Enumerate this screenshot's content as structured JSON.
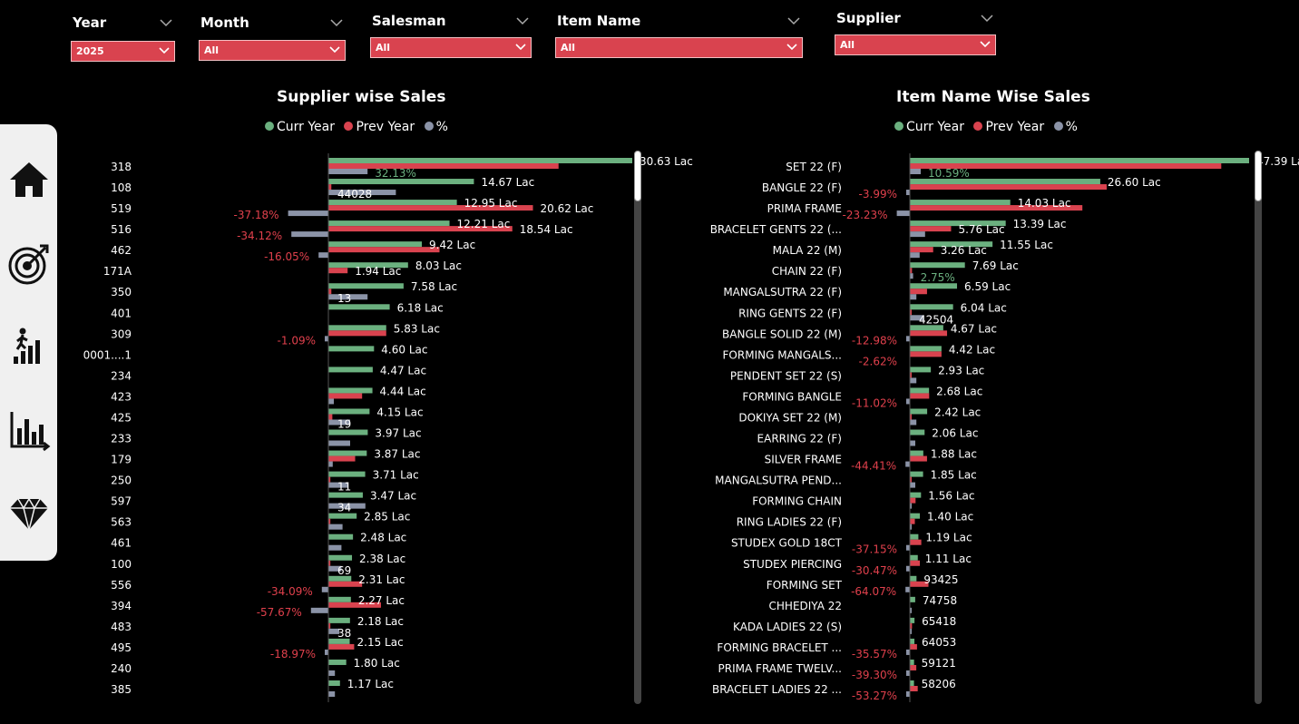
{
  "filters": [
    {
      "title": "Year",
      "value": "2025"
    },
    {
      "title": "Month",
      "value": "All"
    },
    {
      "title": "Salesman",
      "value": "All"
    },
    {
      "title": "Item Name",
      "value": "All"
    },
    {
      "title": "Supplier",
      "value": "All"
    }
  ],
  "nav": {
    "icons": [
      "home-icon",
      "target-icon",
      "growth-icon",
      "bar-chart-icon",
      "diamond-icon"
    ]
  },
  "colors": {
    "curr": "#6bb07f",
    "prev": "#d9434f",
    "pct": "#8b93a7",
    "pos_label": "#6bb07f",
    "neg_label": "#e0404c"
  },
  "supplier_chart": {
    "title": "Supplier wise Sales",
    "legend": [
      "Curr Year",
      "Prev Year",
      "%"
    ]
  },
  "item_chart": {
    "title": "Item Name Wise Sales",
    "legend": [
      "Curr Year",
      "Prev Year",
      "%"
    ]
  },
  "chart_data": [
    {
      "type": "bar",
      "title": "Supplier wise Sales",
      "categories": [
        "318",
        "108",
        "519",
        "516",
        "462",
        "171A",
        "350",
        "401",
        "309",
        "0001....1",
        "234",
        "423",
        "425",
        "233",
        "179",
        "250",
        "597",
        "563",
        "461",
        "100",
        "556",
        "394",
        "483",
        "495",
        "240",
        "385"
      ],
      "series": [
        {
          "name": "Curr Year",
          "values": [
            30.63,
            14.67,
            12.95,
            12.21,
            9.42,
            8.03,
            7.58,
            6.18,
            5.83,
            4.6,
            4.47,
            4.44,
            4.15,
            3.97,
            3.87,
            3.71,
            3.47,
            2.85,
            2.48,
            2.38,
            2.31,
            2.27,
            2.18,
            2.15,
            1.8,
            1.17
          ]
        },
        {
          "name": "Prev Year",
          "values": [
            23.2,
            0.3,
            20.62,
            18.54,
            11.2,
            1.94,
            0.3,
            0,
            5.83,
            0,
            0,
            3.4,
            0.4,
            0,
            2.7,
            0.2,
            0,
            0.2,
            0,
            0.2,
            3.4,
            5.3,
            0.2,
            2.6,
            0,
            0
          ]
        },
        {
          "name": "%",
          "values": [
            32.13,
            44028,
            -37.18,
            -34.12,
            -16.05,
            0,
            13,
            0,
            -1.09,
            0,
            0,
            0,
            19,
            0,
            0,
            11,
            34,
            0,
            0,
            69,
            -34.09,
            -57.67,
            38,
            -18.97,
            0,
            0
          ]
        }
      ],
      "labels": [
        "30.63 Lac",
        "14.67 Lac",
        "12.95 Lac",
        "12.21 Lac",
        "9.42 Lac",
        "8.03 Lac",
        "7.58 Lac",
        "6.18 Lac",
        "5.83 Lac",
        "4.60 Lac",
        "4.47 Lac",
        "4.44 Lac",
        "4.15 Lac",
        "3.97 Lac",
        "3.87 Lac",
        "3.71 Lac",
        "3.47 Lac",
        "2.85 Lac",
        "2.48 Lac",
        "2.38 Lac",
        "2.31 Lac",
        "2.27 Lac",
        "2.18 Lac",
        "2.15 Lac",
        "1.80 Lac",
        "1.17 Lac"
      ],
      "prev_labels": [
        "",
        "",
        "20.62 Lac",
        "18.54 Lac",
        "",
        "1.94 Lac",
        "",
        "",
        "",
        "",
        "",
        "",
        "",
        "",
        "",
        "",
        "",
        "",
        "",
        "",
        "",
        "",
        "",
        "",
        "",
        ""
      ],
      "pct_labels": [
        "32.13%",
        "44028",
        "-37.18%",
        "-34.12%",
        "-16.05%",
        "",
        "13",
        "",
        "-1.09%",
        "",
        "",
        "",
        "19",
        "",
        "",
        "11",
        "34",
        "",
        "",
        "69",
        "-34.09%",
        "-57.67%",
        "38",
        "-18.97%",
        "",
        ""
      ],
      "pct_bar": [
        0.36,
        0.62,
        -0.37,
        -0.34,
        -0.09,
        0,
        0.36,
        0,
        -0.01,
        0,
        0,
        0.05,
        0.2,
        0.2,
        0.04,
        0.18,
        0.34,
        0.13,
        0.12,
        0.12,
        -0.06,
        -0.16,
        0.1,
        -0.02,
        0.06,
        0.06
      ]
    },
    {
      "type": "bar",
      "title": "Item Name Wise Sales",
      "categories": [
        "SET 22 (F)",
        "BANGLE 22 (F)",
        "PRIMA FRAME",
        "BRACELET GENTS 22 (...",
        "MALA 22 (M)",
        "CHAIN 22 (F)",
        "MANGALSUTRA 22 (F)",
        "RING GENTS 22 (F)",
        "BANGLE SOLID 22 (M)",
        "FORMING MANGALS...",
        "PENDENT SET 22 (S)",
        "FORMING BANGLE",
        "DOKIYA SET 22 (M)",
        "EARRING 22 (F)",
        "SILVER FRAME",
        "MANGALSUTRA PEND...",
        "FORMING CHAIN",
        "RING LADIES 22 (F)",
        "STUDEX GOLD 18CT",
        "STUDEX PIERCING",
        "FORMING SET",
        "CHHEDIYA 22",
        "KADA LADIES 22 (S)",
        "FORMING BRACELET ...",
        "PRIMA FRAME TWELV...",
        "BRACELET LADIES 22 ..."
      ],
      "series": [
        {
          "name": "Curr Year",
          "values": [
            47.39,
            26.6,
            14.03,
            13.39,
            11.55,
            7.69,
            6.59,
            6.04,
            4.67,
            4.42,
            2.93,
            2.68,
            2.42,
            2.06,
            1.88,
            1.85,
            1.56,
            1.4,
            1.19,
            1.11,
            0.93,
            0.75,
            0.65,
            0.64,
            0.59,
            0.58
          ]
        },
        {
          "name": "Prev Year",
          "values": [
            43.5,
            27.5,
            24.1,
            5.76,
            3.26,
            0.3,
            2.4,
            0.2,
            5.2,
            4.42,
            0.2,
            2.7,
            0.2,
            0,
            2.4,
            0.2,
            0.8,
            0.7,
            1.6,
            1.4,
            2.6,
            0,
            0.3,
            1.0,
            0.9,
            1.1
          ]
        },
        {
          "name": "%",
          "values": [
            10.59,
            -3.99,
            -23.23,
            0,
            0,
            2.75,
            0,
            42504,
            -12.98,
            -2.62,
            0,
            -11.02,
            0,
            0,
            -44.41,
            0,
            0,
            0,
            -37.15,
            -30.47,
            -64.07,
            0,
            0,
            -35.57,
            -39.3,
            -53.27
          ]
        }
      ],
      "labels": [
        "47.39 Lac",
        "26.60 Lac",
        "14.03 Lac",
        "13.39 Lac",
        "11.55 Lac",
        "7.69 Lac",
        "6.59 Lac",
        "6.04 Lac",
        "4.67 Lac",
        "4.42 Lac",
        "2.93 Lac",
        "2.68 Lac",
        "2.42 Lac",
        "2.06 Lac",
        "1.88 Lac",
        "1.85 Lac",
        "1.56 Lac",
        "1.40 Lac",
        "1.19 Lac",
        "1.11 Lac",
        "93425",
        "74758",
        "65418",
        "64053",
        "59121",
        "58206"
      ],
      "prev_labels": [
        "",
        "",
        "",
        "5.76 Lac",
        "3.26 Lac",
        "",
        "",
        "",
        "",
        "",
        "",
        "",
        "",
        "",
        "",
        "",
        "",
        "",
        "",
        "",
        "",
        "",
        "",
        "",
        "",
        ""
      ],
      "pct_labels": [
        "10.59%",
        "-3.99%",
        "-23.23%",
        "",
        "",
        "2.75%",
        "",
        "42504",
        "-12.98%",
        "-2.62%",
        "",
        "-11.02%",
        "",
        "",
        "-44.41%",
        "",
        "",
        "",
        "-37.15%",
        "-30.47%",
        "-64.07%",
        "",
        "",
        "-35.57%",
        "-39.30%",
        "-53.27%"
      ],
      "pct_bar": [
        0.1,
        -0.03,
        -0.12,
        0.14,
        0.09,
        0.03,
        0.06,
        0.13,
        -0.01,
        0,
        0.06,
        -0.01,
        0.06,
        0.05,
        -0.04,
        0.05,
        0.01,
        0.01,
        -0.01,
        -0.01,
        -0.04,
        0.01,
        0.01,
        -0.01,
        -0.01,
        -0.01
      ]
    }
  ]
}
